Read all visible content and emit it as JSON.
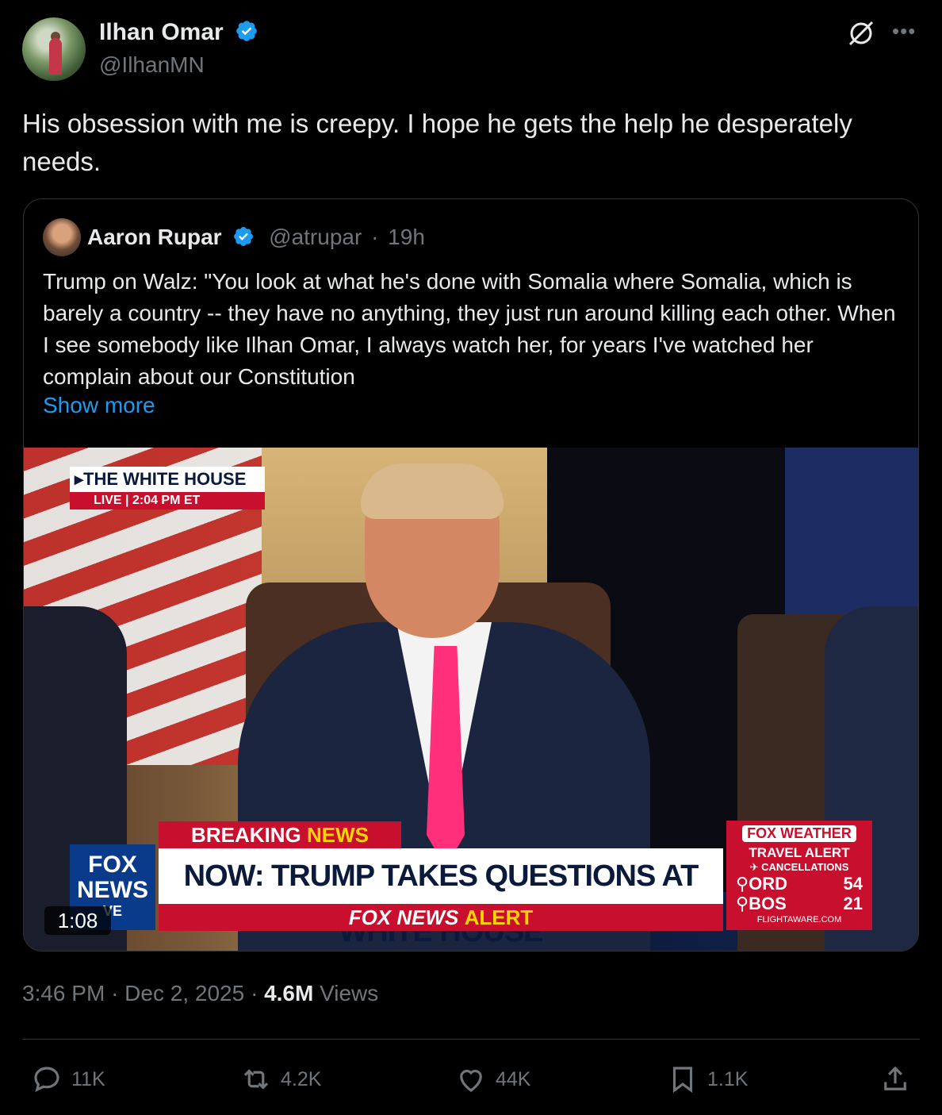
{
  "author": {
    "name": "Ilhan Omar",
    "handle": "@IlhanMN"
  },
  "tweet": {
    "text": "His obsession with me is creepy. I hope he gets the help he desperately needs."
  },
  "quote": {
    "name": "Aaron Rupar",
    "handle": "@atrupar",
    "separator": "·",
    "time": "19h",
    "text": "Trump on Walz: \"You look at what he's done with Somalia where Somalia, which is barely a country -- they have no anything, they just run around killing each other. When I see somebody like Ilhan Omar, I always watch her, for years I've watched her complain about our Constitution",
    "show_more": "Show more"
  },
  "video": {
    "duration": "1:08",
    "bug_title": "▸THE WHITE HOUSE",
    "bug_live": "LIVE",
    "bug_time": "| 2:04 PM ET",
    "breaking": "BREAKING",
    "breaking_news": "NEWS",
    "headline": "NOW: TRUMP TAKES QUESTIONS AT WHITE HOUSE",
    "alert_prefix": "FOX NEWS",
    "alert_word": "ALERT",
    "logo_line1": "FOX",
    "logo_line2": "NEWS",
    "logo_line3": "VE",
    "weather_title": "FOX WEATHER",
    "weather_alert": "TRAVEL ALERT",
    "weather_cancellations": "✈ CANCELLATIONS",
    "weather_rows": [
      {
        "code": "⚲ORD",
        "value": "54"
      },
      {
        "code": "⚲BOS",
        "value": "21"
      }
    ],
    "weather_source": "FLIGHTAWARE.COM"
  },
  "meta": {
    "time": "3:46 PM",
    "separator": "·",
    "date": "Dec 2, 2025",
    "separator2": "·",
    "views_count": "4.6M",
    "views_label": "Views"
  },
  "actions": {
    "replies": "11K",
    "reposts": "4.2K",
    "likes": "44K",
    "bookmarks": "1.1K"
  },
  "colors": {
    "background": "#000000",
    "text": "#e7e9ea",
    "muted": "#71767b",
    "accent": "#1d9bf0",
    "border": "#2f3336"
  },
  "icons": [
    "verified-badge-icon",
    "grok-icon",
    "more-icon",
    "reply-icon",
    "repost-icon",
    "like-icon",
    "bookmark-icon",
    "share-icon"
  ]
}
